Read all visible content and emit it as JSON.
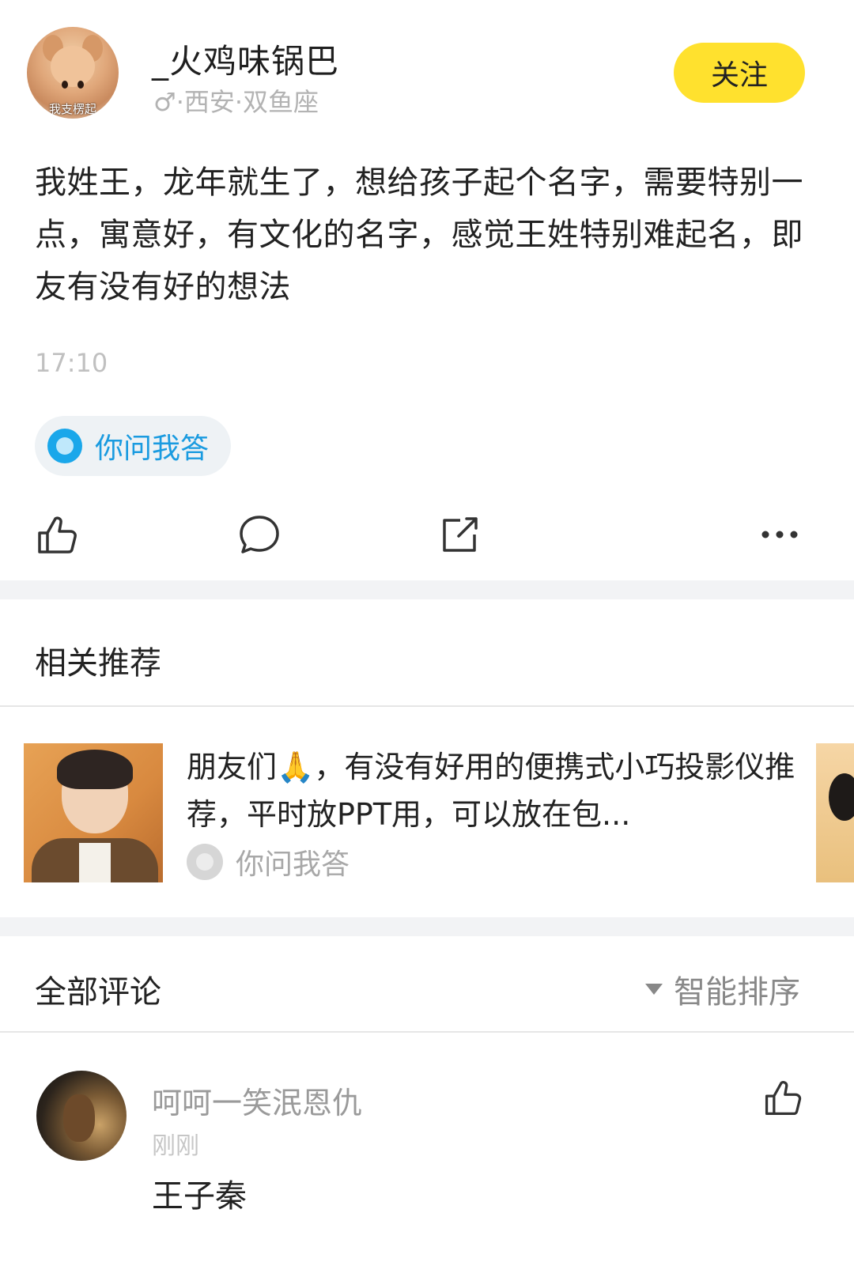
{
  "header": {
    "username": "_火鸡味锅巴",
    "user_info": "♂·西安·双鱼座",
    "avatar_caption": "我支楞起",
    "follow_label": "关注"
  },
  "post": {
    "text": "我姓王，龙年就生了，想给孩子起个名字，需要特别一点，寓意好，有文化的名字，感觉王姓特别难起名，即友有没有好的想法",
    "time": "17:10",
    "tag": "你问我答",
    "actions": [
      "like-icon",
      "comment-icon",
      "share-icon",
      "more-icon"
    ]
  },
  "recommend": {
    "title": "相关推荐",
    "items": [
      {
        "text": "朋友们🙏，有没有好用的便携式小巧投影仪推荐，平时放PPT用，可以放在包...",
        "tag": "你问我答"
      }
    ]
  },
  "comments": {
    "title": "全部评论",
    "sort_label": "智能排序",
    "items": [
      {
        "name": "呵呵一笑泯恩仇",
        "time": "刚刚",
        "text": "王子秦"
      }
    ]
  },
  "colors": {
    "accent_yellow": "#ffe12e",
    "tag_blue": "#1a9be0"
  }
}
